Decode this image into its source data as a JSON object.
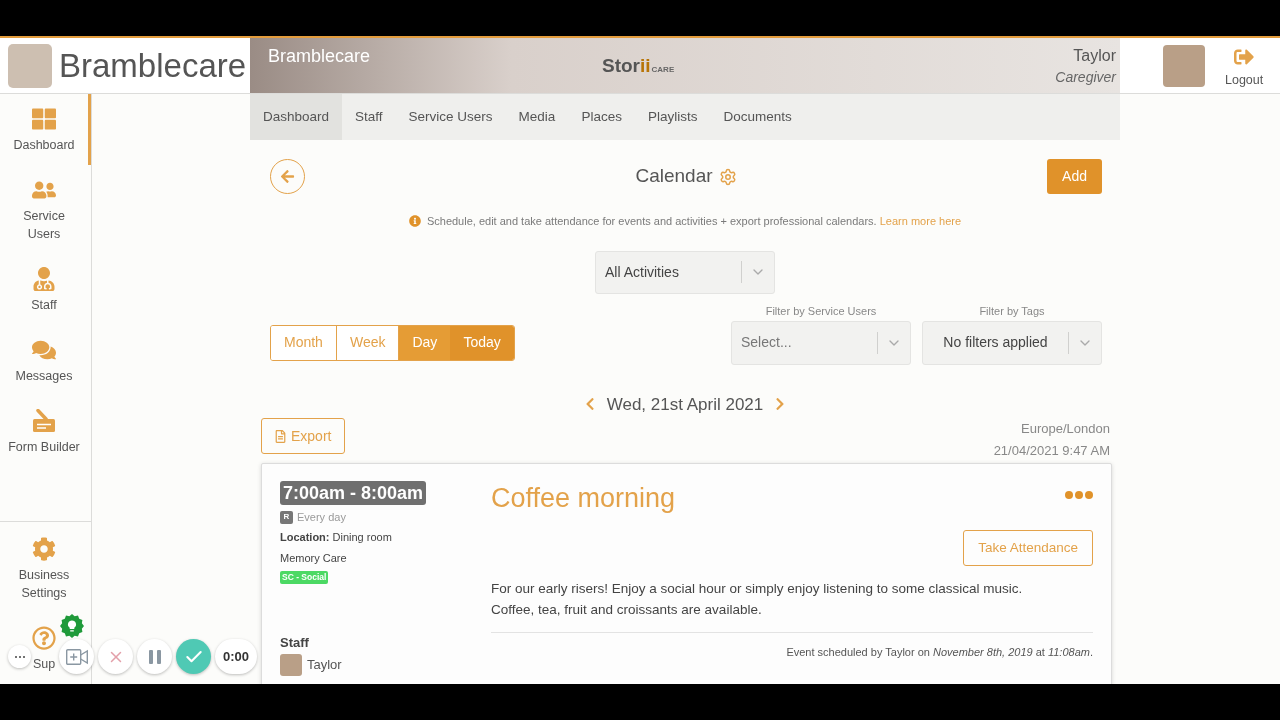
{
  "header": {
    "org_name": "Bramblecare",
    "banner_text": "Bramblecare",
    "logo": {
      "wordmark": "Stor",
      "wordmark_accent": "ii",
      "tagline": "CARE"
    },
    "user": {
      "name": "Taylor",
      "role": "Caregiver"
    },
    "logout": "Logout"
  },
  "sidebar": {
    "items": [
      {
        "label": "Dashboard",
        "selected": true
      },
      {
        "label": "Service Users",
        "selected": false
      },
      {
        "label": "Staff",
        "selected": false
      },
      {
        "label": "Messages",
        "selected": false
      },
      {
        "label": "Form Builder",
        "selected": false
      }
    ],
    "bottom_items": [
      {
        "label": "Business Settings",
        "selected": false
      },
      {
        "label": "Sup",
        "selected": false
      }
    ]
  },
  "nav_tabs": [
    {
      "label": "Dashboard",
      "selected": true
    },
    {
      "label": "Staff",
      "selected": false
    },
    {
      "label": "Service Users",
      "selected": false
    },
    {
      "label": "Media",
      "selected": false
    },
    {
      "label": "Places",
      "selected": false
    },
    {
      "label": "Playlists",
      "selected": false
    },
    {
      "label": "Documents",
      "selected": false
    }
  ],
  "page": {
    "title": "Calendar",
    "add_button": "Add",
    "info": "Schedule, edit and take attendance for events and activities + export professional calendars.",
    "info_link": "Learn more here"
  },
  "activity_filter": {
    "value": "All Activities"
  },
  "view_buttons": [
    {
      "label": "Month",
      "selected": false
    },
    {
      "label": "Week",
      "selected": false
    },
    {
      "label": "Day",
      "selected": true
    }
  ],
  "today_button": "Today",
  "filters": [
    {
      "label": "Filter by Service Users",
      "placeholder": "Select..."
    },
    {
      "label": "Filter by Tags",
      "value": "No filters applied"
    }
  ],
  "date_nav": {
    "date": "Wed, 21st April 2021"
  },
  "export_button": "Export",
  "timezone": "Europe/London",
  "current_time": "21/04/2021 9:47 AM",
  "events": [
    {
      "time": "7:00am - 8:00am",
      "recurrence_badge": "R",
      "recurrence": "Every day",
      "location": "**Location:** Dining room",
      "group": "Memory Care",
      "tags": [
        {
          "label": "SC - Social",
          "color": "#4cd964"
        }
      ],
      "staff_heading": "Staff",
      "staff": [
        {
          "name": "Taylor"
        }
      ],
      "title": "Coffee morning",
      "action": "Take Attendance",
      "description": "For our early risers! Enjoy a social hour or simply enjoy listening to some classical music. Coffee, tea, fruit and croissants are available.",
      "footer": "Event scheduled by Taylor on *November 8th, 2019* at *11:08am*."
    }
  ],
  "recorder": {
    "timer": "0:00"
  }
}
